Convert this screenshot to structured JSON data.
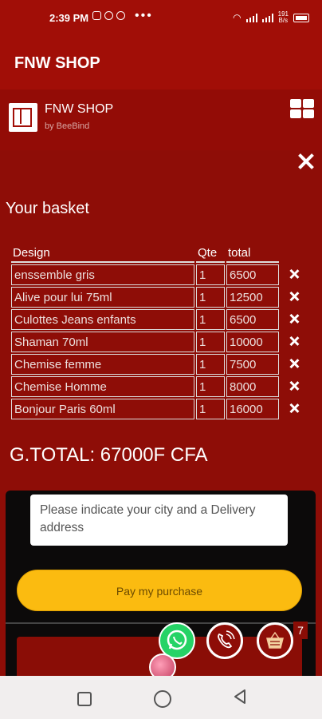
{
  "status": {
    "time": "2:39 PM",
    "net": "191\nB/s"
  },
  "app": {
    "title": "FNW SHOP"
  },
  "brand": {
    "name": "FNW SHOP",
    "sub": "by BeeBind"
  },
  "basket": {
    "title": "Your basket",
    "headers": [
      "Design",
      "Qte",
      "total"
    ],
    "rows": [
      {
        "design": "enssemble gris",
        "qte": "1",
        "total": "6500"
      },
      {
        "design": "Alive pour lui 75ml",
        "qte": "1",
        "total": "12500"
      },
      {
        "design": "Culottes Jeans enfants",
        "qte": "1",
        "total": "6500"
      },
      {
        "design": "Shaman 70ml",
        "qte": "1",
        "total": "10000"
      },
      {
        "design": "Chemise femme",
        "qte": "1",
        "total": "7500"
      },
      {
        "design": "Chemise Homme",
        "qte": "1",
        "total": "8000"
      },
      {
        "design": "Bonjour Paris 60ml",
        "qte": "1",
        "total": "16000"
      }
    ],
    "grand_total": "G.TOTAL: 67000F CFA"
  },
  "checkout": {
    "address_placeholder": "Please indicate your city and a Delivery address",
    "pay_label": "Pay my purchase"
  },
  "cart_badge": "7",
  "colors": {
    "background": "#8e0d07",
    "pay_button": "#fbbb10",
    "whatsapp": "#25d366"
  }
}
